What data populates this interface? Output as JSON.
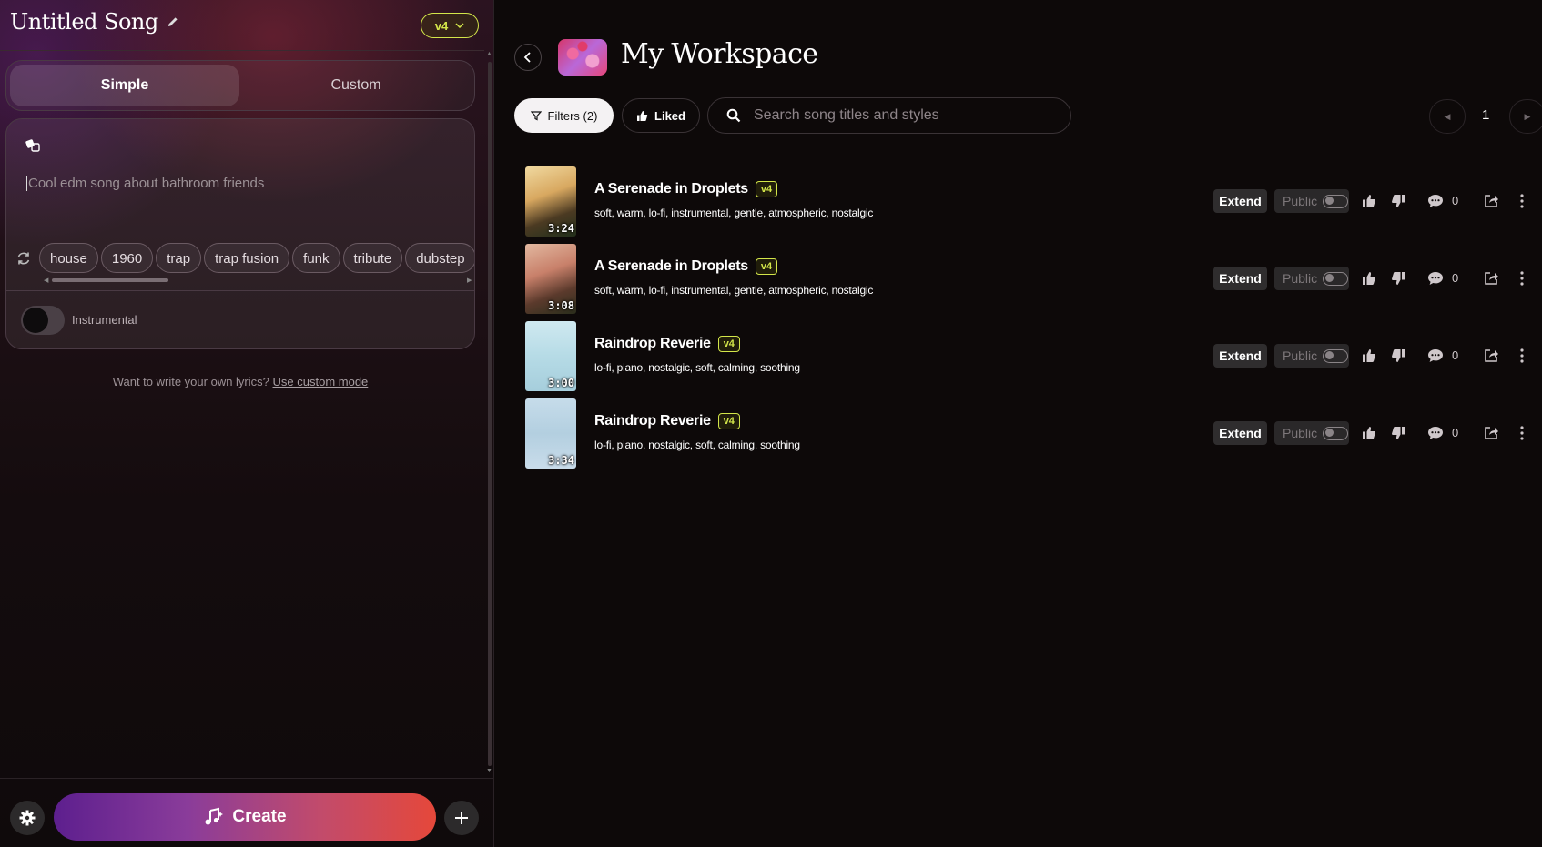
{
  "editor": {
    "song_title": "Untitled Song",
    "model_version": "v4",
    "modes": [
      "Simple",
      "Custom"
    ],
    "prompt_placeholder": "Cool edm song about bathroom friends",
    "style_tags": [
      "house",
      "1960",
      "trap",
      "trap fusion",
      "funk",
      "tribute",
      "dubstep"
    ],
    "instrumental_label": "Instrumental",
    "lyrics_hint": "Want to write your own lyrics?",
    "lyrics_hint_link": "Use custom mode",
    "create_label": "Create"
  },
  "workspace": {
    "title": "My Workspace",
    "filters_label": "Filters (2)",
    "liked_label": "Liked",
    "search_placeholder": "Search song titles and styles",
    "page": "1"
  },
  "songs": [
    {
      "title": "A Serenade in Droplets",
      "version": "v4",
      "styles": "soft, warm, lo-fi, instrumental, gentle, atmospheric, nostalgic",
      "duration": "3:24",
      "extend_label": "Extend",
      "public_label": "Public",
      "comments": "0"
    },
    {
      "title": "A Serenade in Droplets",
      "version": "v4",
      "styles": "soft, warm, lo-fi, instrumental, gentle, atmospheric, nostalgic",
      "duration": "3:08",
      "extend_label": "Extend",
      "public_label": "Public",
      "comments": "0"
    },
    {
      "title": "Raindrop Reverie",
      "version": "v4",
      "styles": "lo-fi, piano, nostalgic, soft, calming, soothing",
      "duration": "3:00",
      "extend_label": "Extend",
      "public_label": "Public",
      "comments": "0"
    },
    {
      "title": "Raindrop Reverie",
      "version": "v4",
      "styles": "lo-fi, piano, nostalgic, soft, calming, soothing",
      "duration": "3:34",
      "extend_label": "Extend",
      "public_label": "Public",
      "comments": "0"
    }
  ],
  "colors": {
    "accent_version": "#d3e64a",
    "create_gradient_start": "#5d1f8e",
    "create_gradient_end": "#e5483a"
  }
}
